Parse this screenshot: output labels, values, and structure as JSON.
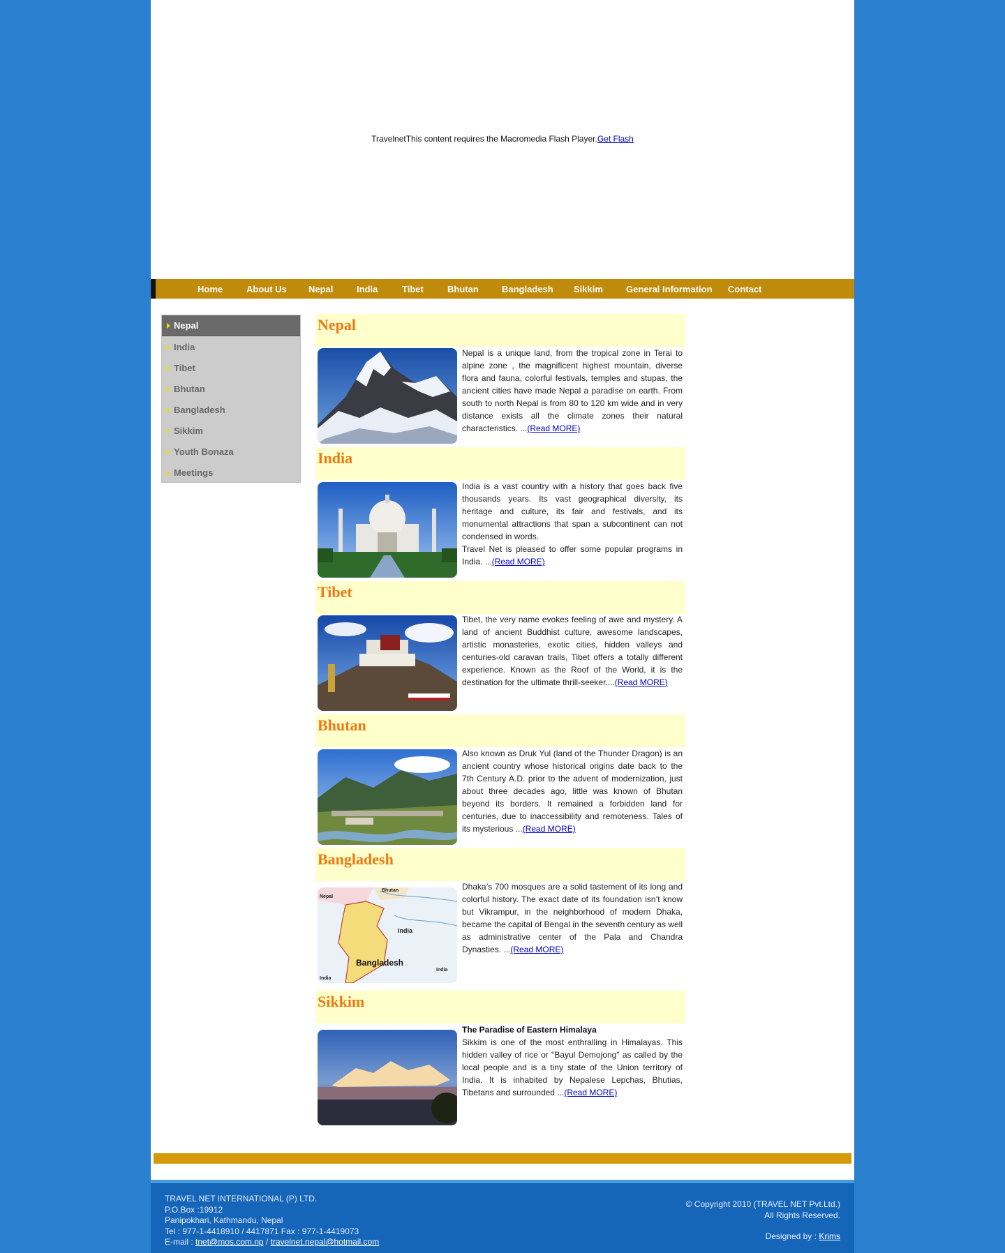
{
  "flash": {
    "alt_text": "TravelnetThis content requires the Macromedia Flash Player.",
    "get_flash_link": "Get Flash"
  },
  "nav": {
    "items": [
      "Home",
      "About Us",
      "Nepal",
      "India",
      "Tibet",
      "Bhutan",
      "Bangladesh",
      "Sikkim",
      "General Information",
      "Contact"
    ]
  },
  "sidebar": {
    "active": "Nepal",
    "items": [
      "Nepal",
      "India",
      "Tibet",
      "Bhutan",
      "Bangladesh",
      "Sikkim",
      "Youth Bonaza",
      "Meetings"
    ]
  },
  "sections": [
    {
      "title": "Nepal",
      "image": "everest-mountain-photo",
      "subtitle": "",
      "text": "Nepal is a unique land, from the tropical zone in Terai to alpine zone , the magnificent highest mountain, diverse flora and fauna, colorful festivals, temples and stupas, the ancient cities have made Nepal a paradise on earth. From south to north Nepal is from 80 to 120 km wide and in very distance exists all the climate zones their natural characteristics. ...",
      "read_more": "(Read MORE)"
    },
    {
      "title": "India",
      "image": "taj-mahal-photo",
      "subtitle": "",
      "text": "India is a vast country with a history that goes back five thousands years. Its vast geographical diversity, its heritage and culture, its fair and festivals, and its monumental attractions that span a subcontinent can not condensed in words.",
      "text2": "Travel Net is pleased to offer some popular programs in India. ...",
      "read_more": "(Read MORE)"
    },
    {
      "title": "Tibet",
      "image": "potala-palace-photo",
      "subtitle": "",
      "text": "Tibet, the very name evokes feeling of awe and mystery. A land of ancient Buddhist culture, awesome landscapes, artistic monasteries, exotic cities, hidden valleys and centuries-old caravan trails, Tibet offers a totally different experience. Known as the Roof of the World, it is the destination for the ultimate thrill-seeker....",
      "read_more": "(Read MORE)"
    },
    {
      "title": "Bhutan",
      "image": "paro-valley-photo",
      "subtitle": "",
      "text": "Also known as Druk Yul (land of the Thunder Dragon) is an ancient country whose historical origins date back to the 7th Century A.D. prior to the advent of modernization, just about three decades ago, little was known of Bhutan beyond its borders. It remained a forbidden land for centuries, due to inaccessibility and remoteness. Tales of its mysterious ...",
      "read_more": "(Read MORE)"
    },
    {
      "title": "Bangladesh",
      "image": "bangladesh-map",
      "subtitle": "",
      "text": "Dhaka’s 700 mosques are a solid tastement of its long and colorful history. The exact date of its foundation isn’t know but Vikrampur, in the neighborhood of modern Dhaka, became the capital of Bengal in the seventh century as well as administrative center of the Pala and Chandra Dynasties. ...",
      "read_more": "(Read MORE)",
      "map_labels": [
        "Nepal",
        "Bhutan",
        "India",
        "Bangladesh",
        "India",
        "India"
      ]
    },
    {
      "title": "Sikkim",
      "image": "sunset-mountains-photo",
      "subtitle": "The Paradise of Eastern Himalaya",
      "text": "Sikkim is one of the most enthralling in Himalayas. This hidden valley of rice or \"Bayul Demojong\" as called by the local people and is a tiny state of the Union territory of India. It is inhabited by Nepalese Lepchas, Bhutias, Tibetans and surrounded ...",
      "read_more": "(Read MORE)"
    }
  ],
  "footer": {
    "company": "TRAVEL NET INTERNATIONAL (P) LTD.",
    "pobox": "P.O.Box :19912",
    "address": "Panipokhari, Kathmandu, Nepal",
    "phone": "Tel : 977-1-4418910 / 4417871 Fax : 977-1-4419073",
    "email_label": "E-mail :",
    "email1": "tnet@mos.com.np",
    "email_sep": " / ",
    "email2": "travelnet.nepal@hotmail.com",
    "copyright": "© Copyright 2010 (TRAVEL NET Pvt.Ltd.)",
    "rights": "All Rights Reserved.",
    "designed_label": "Designed by :",
    "designer": "Krims"
  },
  "colors": {
    "background": "#2a7fcf",
    "nav": "#c08a0a",
    "section_header": "#ffffcc",
    "section_title": "#f07810",
    "footer": "#1565b8",
    "gold_bar": "#d49a0a"
  }
}
